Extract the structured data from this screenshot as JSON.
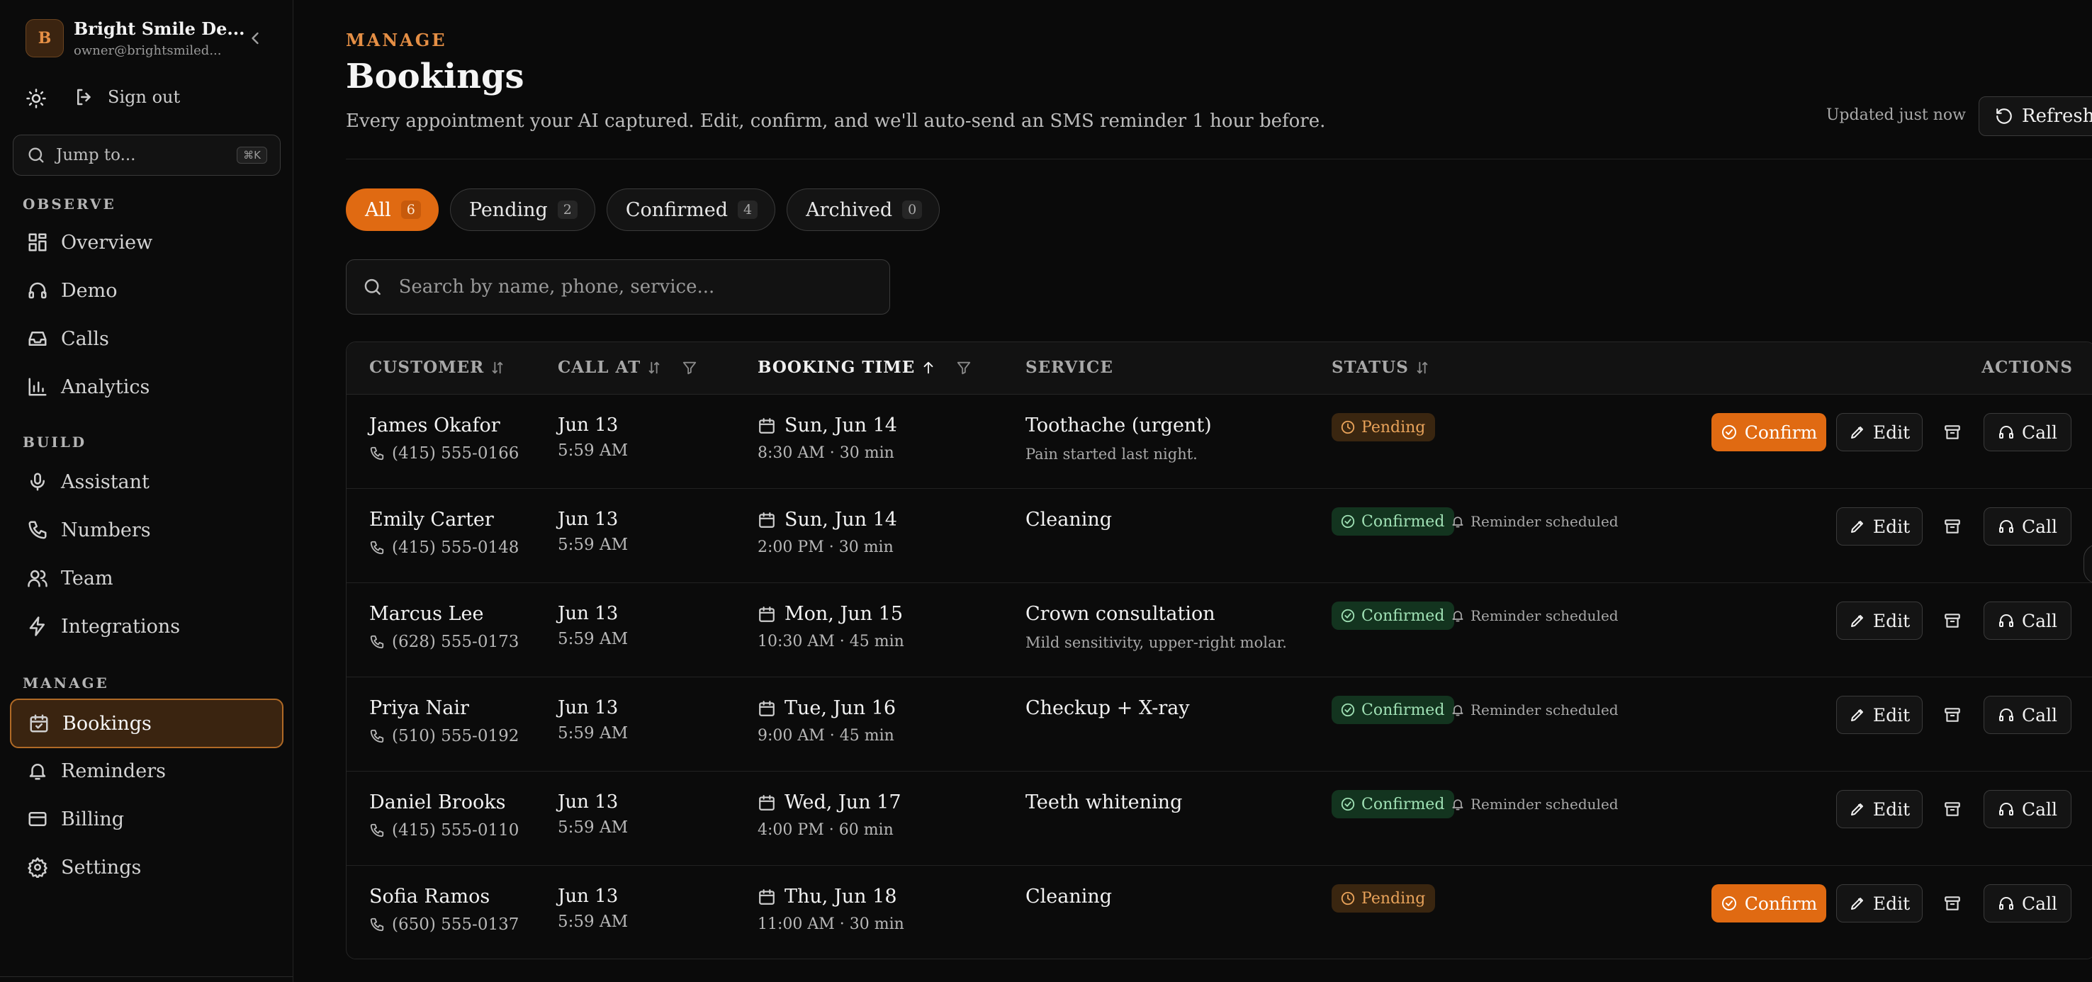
{
  "org": {
    "initial": "B",
    "name": "Bright Smile De...",
    "email": "owner@brightsmiled..."
  },
  "sidebar": {
    "signout_label": "Sign out",
    "jump_placeholder": "Jump to...",
    "jump_shortcut": "⌘K",
    "sections": {
      "observe": "OBSERVE",
      "build": "BUILD",
      "manage": "MANAGE"
    },
    "items": {
      "overview": "Overview",
      "demo": "Demo",
      "calls": "Calls",
      "analytics": "Analytics",
      "assistant": "Assistant",
      "numbers": "Numbers",
      "team": "Team",
      "integrations": "Integrations",
      "bookings": "Bookings",
      "reminders": "Reminders",
      "billing": "Billing",
      "settings": "Settings"
    }
  },
  "header": {
    "eyebrow": "MANAGE",
    "title": "Bookings",
    "subtitle": "Every appointment your AI captured. Edit, confirm, and we'll auto-send an SMS reminder 1 hour before.",
    "updated": "Updated just now",
    "refresh_label": "Refresh"
  },
  "tabs": [
    {
      "label": "All",
      "count": "6"
    },
    {
      "label": "Pending",
      "count": "2"
    },
    {
      "label": "Confirmed",
      "count": "4"
    },
    {
      "label": "Archived",
      "count": "0"
    }
  ],
  "search": {
    "placeholder": "Search by name, phone, service..."
  },
  "table": {
    "columns": {
      "customer": "CUSTOMER",
      "call_at": "CALL AT",
      "booking_time": "BOOKING TIME",
      "service": "SERVICE",
      "status": "STATUS",
      "actions": "ACTIONS"
    },
    "actions": {
      "confirm": "Confirm",
      "edit": "Edit",
      "call": "Call"
    },
    "rows": [
      {
        "name": "James Okafor",
        "phone": "(415) 555-0166",
        "call_date": "Jun 13",
        "call_time": "5:59 AM",
        "booking_date": "Sun, Jun 14",
        "booking_detail": "8:30 AM · 30 min",
        "service": "Toothache (urgent)",
        "note": "Pain started last night.",
        "status": "Pending",
        "reminder": ""
      },
      {
        "name": "Emily Carter",
        "phone": "(415) 555-0148",
        "call_date": "Jun 13",
        "call_time": "5:59 AM",
        "booking_date": "Sun, Jun 14",
        "booking_detail": "2:00 PM · 30 min",
        "service": "Cleaning",
        "note": "",
        "status": "Confirmed",
        "reminder": "Reminder scheduled"
      },
      {
        "name": "Marcus Lee",
        "phone": "(628) 555-0173",
        "call_date": "Jun 13",
        "call_time": "5:59 AM",
        "booking_date": "Mon, Jun 15",
        "booking_detail": "10:30 AM · 45 min",
        "service": "Crown consultation",
        "note": "Mild sensitivity, upper-right molar.",
        "status": "Confirmed",
        "reminder": "Reminder scheduled"
      },
      {
        "name": "Priya Nair",
        "phone": "(510) 555-0192",
        "call_date": "Jun 13",
        "call_time": "5:59 AM",
        "booking_date": "Tue, Jun 16",
        "booking_detail": "9:00 AM · 45 min",
        "service": "Checkup + X-ray",
        "note": "",
        "status": "Confirmed",
        "reminder": "Reminder scheduled"
      },
      {
        "name": "Daniel Brooks",
        "phone": "(415) 555-0110",
        "call_date": "Jun 13",
        "call_time": "5:59 AM",
        "booking_date": "Wed, Jun 17",
        "booking_detail": "4:00 PM · 60 min",
        "service": "Teeth whitening",
        "note": "",
        "status": "Confirmed",
        "reminder": "Reminder scheduled"
      },
      {
        "name": "Sofia Ramos",
        "phone": "(650) 555-0137",
        "call_date": "Jun 13",
        "call_time": "5:59 AM",
        "booking_date": "Thu, Jun 18",
        "booking_detail": "11:00 AM · 30 min",
        "service": "Cleaning",
        "note": "",
        "status": "Pending",
        "reminder": ""
      }
    ]
  },
  "colors": {
    "accent": "#e06a12",
    "pending": "#e9a35a",
    "confirmed": "#9fe0b4",
    "background": "#0a0a0a"
  }
}
